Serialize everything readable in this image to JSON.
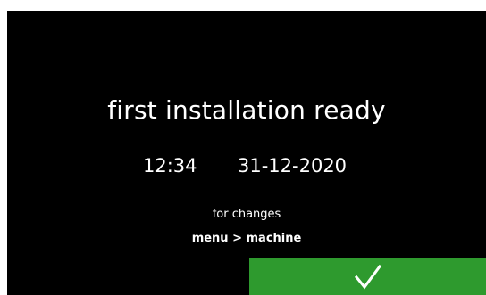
{
  "screen": {
    "title": "first installation ready",
    "time": "12:34",
    "date": "31-12-2020",
    "hint": "for changes",
    "menu_path": "menu > machine"
  },
  "confirm_button": {
    "icon": "checkmark-icon",
    "color": "#2e9a2e"
  },
  "colors": {
    "background": "#000000",
    "text": "#ffffff",
    "accent": "#2e9a2e"
  }
}
